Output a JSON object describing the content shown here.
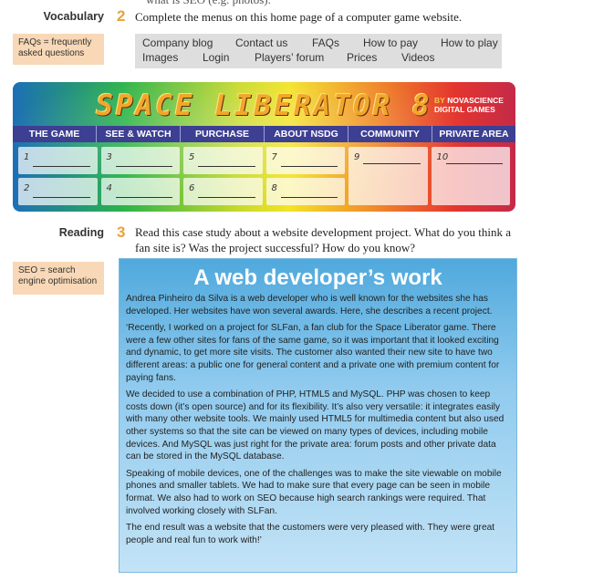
{
  "top_cut_text": "what is SEO (e.g. photos).",
  "vocabulary": {
    "label": "Vocabulary",
    "number": "2",
    "instruction": "Complete the menus on this home page of a computer game website.",
    "note": "FAQs = frequently asked questions",
    "menu_items_row1": [
      "Company blog",
      "Contact us",
      "FAQs",
      "How to pay",
      "How to play"
    ],
    "menu_items_row2": [
      "Images",
      "Login",
      "Players’ forum",
      "Prices",
      "Videos"
    ]
  },
  "banner": {
    "title": "SPACE LIBERATOR 8",
    "brand_by": "BY",
    "brand_name_1": "NOVASCIENCE",
    "brand_name_2": "DIGITAL GAMES",
    "nav": [
      "THE GAME",
      "SEE & WATCH",
      "PURCHASE",
      "ABOUT NSDG",
      "COMMUNITY",
      "PRIVATE AREA"
    ],
    "blanks": [
      "1",
      "2",
      "3",
      "4",
      "5",
      "6",
      "7",
      "8",
      "9",
      "10"
    ]
  },
  "reading": {
    "label": "Reading",
    "number": "3",
    "instruction_line1": "Read this case study about a website development project. What do you think a",
    "instruction_line2": "fan site is? Was the project successful? How do you know?",
    "note": "SEO = search engine optimisation"
  },
  "article": {
    "title": "A web developer’s work",
    "paragraphs": [
      "Andrea Pinheiro da Silva is a web developer who is well known for the websites she has developed. Her websites have won several awards. Here, she describes a recent project.",
      "‘Recently, I worked on a project for SLFan, a fan club for the Space Liberator game. There were a few other sites for fans of the same game, so it was important that it looked exciting and dynamic, to get more site visits. The customer also wanted their new site to have two different areas: a public one for general content and a private one with premium content for paying fans.",
      "We decided to use a combination of PHP, HTML5 and MySQL. PHP was chosen to keep costs down (it’s open source) and for its flexibility. It’s also very versatile: it integrates easily with many other website tools. We mainly used HTML5 for multimedia content but also used other systems so that the site can be viewed on many types of devices, including mobile devices. And MySQL was just right for the private area: forum posts and other private data can be stored in the MySQL database.",
      "Speaking of mobile devices, one of the challenges was to make the site viewable on mobile phones and smaller tablets. We had to make sure that every page can be seen in mobile format. We also had to work on SEO because high search rankings were required. That involved working closely with SLFan.",
      "The end result was a website that the customers were very pleased with. They were great people and real fun to work with!’"
    ]
  }
}
